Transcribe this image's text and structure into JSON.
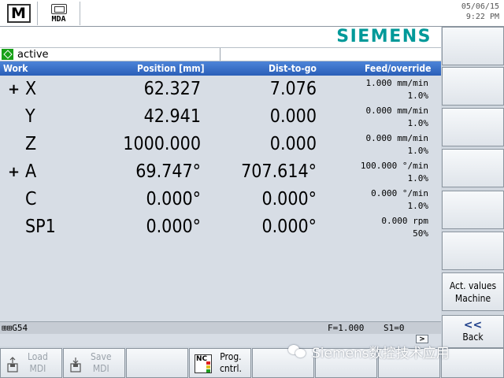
{
  "topbar": {
    "mode_m_label": "M",
    "mode_mda_label": "MDA",
    "date": "05/06/15",
    "time": "9:22 PM"
  },
  "brand": "SIEMENS",
  "status": {
    "text": "active",
    "icon": "active-diamond-icon",
    "color": "#18a018"
  },
  "table": {
    "headers": {
      "work": "Work",
      "position": "Position [mm]",
      "dist": "Dist-to-go",
      "feed": "Feed/override"
    },
    "rows": [
      {
        "mark": "+",
        "axis": "X",
        "position": "62.327",
        "dist": "7.076",
        "feed": "1.000 mm/min",
        "override": "1.0%"
      },
      {
        "mark": "",
        "axis": "Y",
        "position": "42.941",
        "dist": "0.000",
        "feed": "0.000 mm/min",
        "override": "1.0%"
      },
      {
        "mark": "",
        "axis": "Z",
        "position": "1000.000",
        "dist": "0.000",
        "feed": "0.000 mm/min",
        "override": "1.0%"
      },
      {
        "mark": "+",
        "axis": "A",
        "position": "69.747°",
        "dist": "707.614°",
        "feed": "100.000 °/min",
        "override": "1.0%"
      },
      {
        "mark": "",
        "axis": "C",
        "position": "0.000°",
        "dist": "0.000°",
        "feed": "0.000 °/min",
        "override": "1.0%"
      },
      {
        "mark": "",
        "axis": "SP1",
        "position": "0.000°",
        "dist": "0.000°",
        "feed": "0.000 rpm",
        "override": "50%"
      }
    ]
  },
  "bottomline": {
    "frame": "⊞⊞G54",
    "feed": "F=1.000",
    "spindle": "S1=0"
  },
  "scroll_label": ">",
  "softkeys_right": [
    {
      "label": ""
    },
    {
      "label": ""
    },
    {
      "label": ""
    },
    {
      "label": ""
    },
    {
      "label": ""
    },
    {
      "label": ""
    },
    {
      "line1": "Act. values",
      "line2": "Machine"
    },
    {
      "arrows": "<<",
      "label": "Back"
    }
  ],
  "softkeys_bottom": [
    {
      "line1": "Load",
      "line2": "MDI",
      "enabled": false
    },
    {
      "line1": "Save",
      "line2": "MDI",
      "enabled": false
    },
    {
      "label": ""
    },
    {
      "line1": "Prog.",
      "line2": "cntrl.",
      "icon_text": "NC"
    }
  ],
  "watermark": "Siemens数控技术应用",
  "colors": {
    "accent": "#009999",
    "header": "#2a5fb8",
    "panel": "#d7dde5"
  }
}
